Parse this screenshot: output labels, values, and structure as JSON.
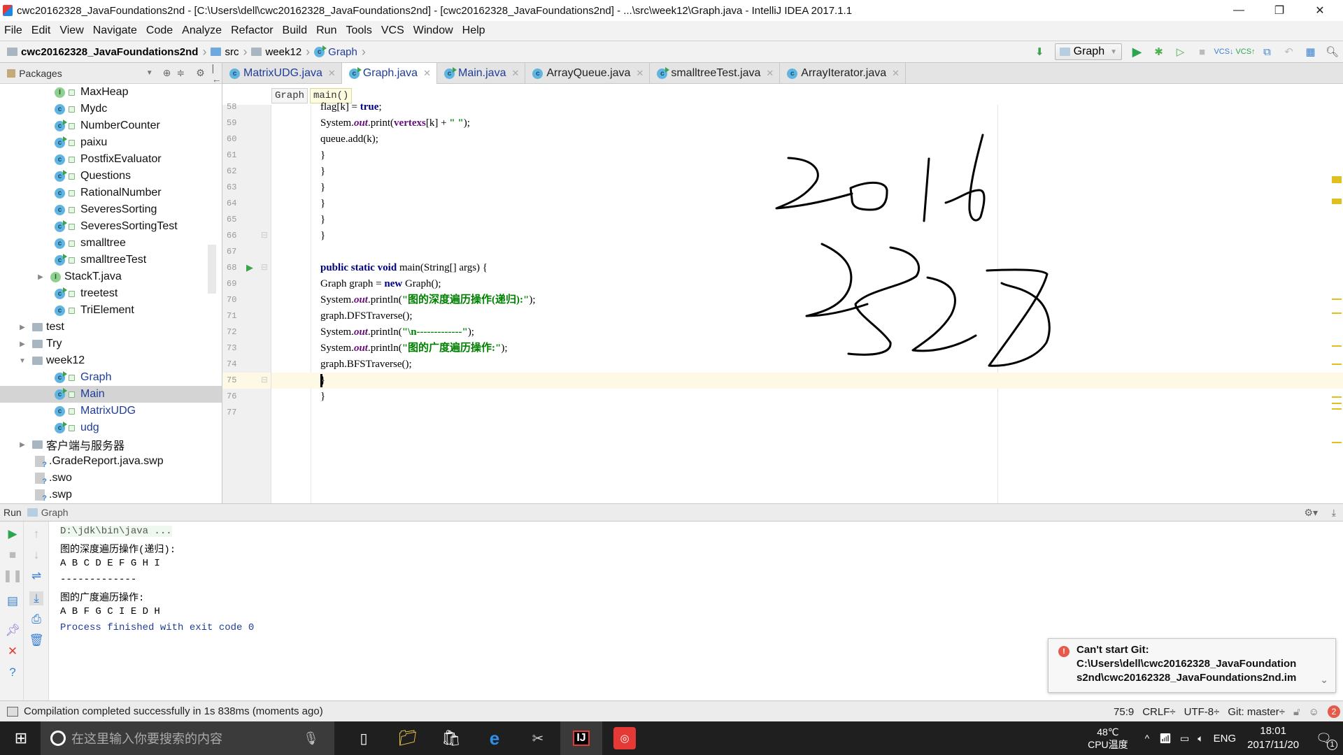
{
  "window": {
    "title": "cwc20162328_JavaFoundations2nd - [C:\\Users\\dell\\cwc20162328_JavaFoundations2nd] - [cwc20162328_JavaFoundations2nd] - ...\\src\\week12\\Graph.java - IntelliJ IDEA 2017.1.1",
    "minimize": "—",
    "restore": "❐",
    "close": "✕"
  },
  "menu": [
    "File",
    "Edit",
    "View",
    "Navigate",
    "Code",
    "Analyze",
    "Refactor",
    "Build",
    "Run",
    "Tools",
    "VCS",
    "Window",
    "Help"
  ],
  "navbar": {
    "crumbs": [
      "cwc20162328_JavaFoundations2nd",
      "src",
      "week12",
      "Graph"
    ],
    "run_config": "Graph"
  },
  "sidebar": {
    "header": "Packages",
    "items": [
      {
        "label": "MaxHeap",
        "type": "interface",
        "indent": 2
      },
      {
        "label": "Mydc",
        "type": "class",
        "indent": 2
      },
      {
        "label": "NumberCounter",
        "type": "runnable",
        "indent": 2
      },
      {
        "label": "paixu",
        "type": "runnable",
        "indent": 2
      },
      {
        "label": "PostfixEvaluator",
        "type": "class",
        "indent": 2
      },
      {
        "label": "Questions",
        "type": "runnable",
        "indent": 2
      },
      {
        "label": "RationalNumber",
        "type": "class",
        "indent": 2
      },
      {
        "label": "SeveresSorting",
        "type": "class",
        "indent": 2
      },
      {
        "label": "SeveresSortingTest",
        "type": "runnable",
        "indent": 2
      },
      {
        "label": "smalltree",
        "type": "class",
        "indent": 2
      },
      {
        "label": "smalltreeTest",
        "type": "runnable",
        "indent": 2
      },
      {
        "label": "StackT.java",
        "type": "interface-file",
        "indent": 1
      },
      {
        "label": "treetest",
        "type": "runnable",
        "indent": 2
      },
      {
        "label": "TriElement",
        "type": "class",
        "indent": 2
      },
      {
        "label": "test",
        "type": "folder",
        "indent": 0
      },
      {
        "label": "Try",
        "type": "folder",
        "indent": 0
      },
      {
        "label": "week12",
        "type": "folder-open",
        "indent": 0
      },
      {
        "label": "Graph",
        "type": "runnable",
        "indent": 2,
        "blue": true
      },
      {
        "label": "Main",
        "type": "runnable",
        "indent": 2,
        "blue": true,
        "selected": true
      },
      {
        "label": "MatrixUDG",
        "type": "class",
        "indent": 2,
        "blue": true
      },
      {
        "label": "udg",
        "type": "runnable",
        "indent": 2,
        "blue": true
      },
      {
        "label": "客户端与服务器",
        "type": "folder",
        "indent": 0
      },
      {
        "label": ".GradeReport.java.swp",
        "type": "unknown",
        "indent": 1
      },
      {
        "label": ".swo",
        "type": "unknown",
        "indent": 1
      },
      {
        "label": ".swp",
        "type": "unknown",
        "indent": 1
      }
    ]
  },
  "tabs": [
    {
      "label": "MatrixUDG.java",
      "active": false,
      "blue": true
    },
    {
      "label": "Graph.java",
      "active": true,
      "blue": true
    },
    {
      "label": "Main.java",
      "active": false,
      "blue": true
    },
    {
      "label": "ArrayQueue.java",
      "active": false
    },
    {
      "label": "smalltreeTest.java",
      "active": false
    },
    {
      "label": "ArrayIterator.java",
      "active": false
    }
  ],
  "editor_breadcrumb": [
    "Graph",
    "main()"
  ],
  "code": {
    "line_numbers": [
      "58",
      "59",
      "60",
      "61",
      "62",
      "63",
      "64",
      "65",
      "66",
      "67",
      "68",
      "69",
      "70",
      "71",
      "72",
      "73",
      "74",
      "75",
      "76",
      "77"
    ],
    "current_line": "75",
    "lines": [
      [
        {
          "t": "flag[k] = ",
          "c": ""
        },
        {
          "t": "true",
          "c": "kw"
        },
        {
          "t": ";",
          "c": ""
        }
      ],
      [
        {
          "t": "System.",
          "c": ""
        },
        {
          "t": "out",
          "c": "fld"
        },
        {
          "t": ".print(",
          "c": ""
        },
        {
          "t": "vertexs",
          "c": "var"
        },
        {
          "t": "[k] + ",
          "c": ""
        },
        {
          "t": "\" \"",
          "c": "st"
        },
        {
          "t": ");",
          "c": ""
        }
      ],
      [
        {
          "t": "queue.add(k);",
          "c": ""
        }
      ],
      [
        {
          "t": "}",
          "c": ""
        }
      ],
      [
        {
          "t": "}",
          "c": ""
        }
      ],
      [
        {
          "t": "}",
          "c": ""
        }
      ],
      [
        {
          "t": "}",
          "c": ""
        }
      ],
      [
        {
          "t": "}",
          "c": ""
        }
      ],
      [
        {
          "t": "}",
          "c": ""
        }
      ],
      [],
      [
        {
          "t": "public static void ",
          "c": "kw"
        },
        {
          "t": "main(String[] args) {",
          "c": ""
        }
      ],
      [
        {
          "t": "Graph graph = ",
          "c": ""
        },
        {
          "t": "new ",
          "c": "kw"
        },
        {
          "t": "Graph();",
          "c": ""
        }
      ],
      [
        {
          "t": "System.",
          "c": ""
        },
        {
          "t": "out",
          "c": "fld"
        },
        {
          "t": ".println(",
          "c": ""
        },
        {
          "t": "\"图的深度遍历操作(递归):\"",
          "c": "st"
        },
        {
          "t": ");",
          "c": ""
        }
      ],
      [
        {
          "t": "graph.DFSTraverse();",
          "c": ""
        }
      ],
      [
        {
          "t": "System.",
          "c": ""
        },
        {
          "t": "out",
          "c": "fld"
        },
        {
          "t": ".println(",
          "c": ""
        },
        {
          "t": "\"\\n-------------\"",
          "c": "st"
        },
        {
          "t": ");",
          "c": ""
        }
      ],
      [
        {
          "t": "System.",
          "c": ""
        },
        {
          "t": "out",
          "c": "fld"
        },
        {
          "t": ".println(",
          "c": ""
        },
        {
          "t": "\"图的广度遍历操作:\"",
          "c": "st"
        },
        {
          "t": ");",
          "c": ""
        }
      ],
      [
        {
          "t": "graph.BFSTraverse();",
          "c": ""
        }
      ],
      [
        {
          "t": "}",
          "c": ""
        }
      ],
      [
        {
          "t": "}",
          "c": ""
        }
      ],
      []
    ]
  },
  "handwriting": [
    "2016",
    "2328"
  ],
  "run_panel": {
    "label": "Run",
    "config": "Graph",
    "output": [
      {
        "text": "D:\\jdk\\bin\\java ...",
        "kind": "cmd"
      },
      {
        "text": "图的深度遍历操作(递归):",
        "kind": "out"
      },
      {
        "text": "A B C D E F G H I",
        "kind": "out"
      },
      {
        "text": "-------------",
        "kind": "out"
      },
      {
        "text": "图的广度遍历操作:",
        "kind": "out"
      },
      {
        "text": "A B F G C I E D H",
        "kind": "out"
      },
      {
        "text": "Process finished with exit code 0",
        "kind": "proc"
      }
    ]
  },
  "notification": {
    "title": "Can't start Git:",
    "body1": "C:\\Users\\dell\\cwc20162328_JavaFoundation",
    "body2": "s2nd\\cwc20162328_JavaFoundations2nd.im"
  },
  "statusbar": {
    "message": "Compilation completed successfully in 1s 838ms (moments ago)",
    "position": "75:9",
    "line_sep": "CRLF÷",
    "encoding": "UTF-8÷",
    "vcs": "Git: master÷",
    "notif_count": "2"
  },
  "taskbar": {
    "search_placeholder": "在这里输入你要搜索的内容",
    "cpu_temp": "48℃",
    "cpu_label": "CPU温度",
    "lang": "ENG",
    "time": "18:01",
    "date": "2017/11/20",
    "action_center_count": "1"
  }
}
